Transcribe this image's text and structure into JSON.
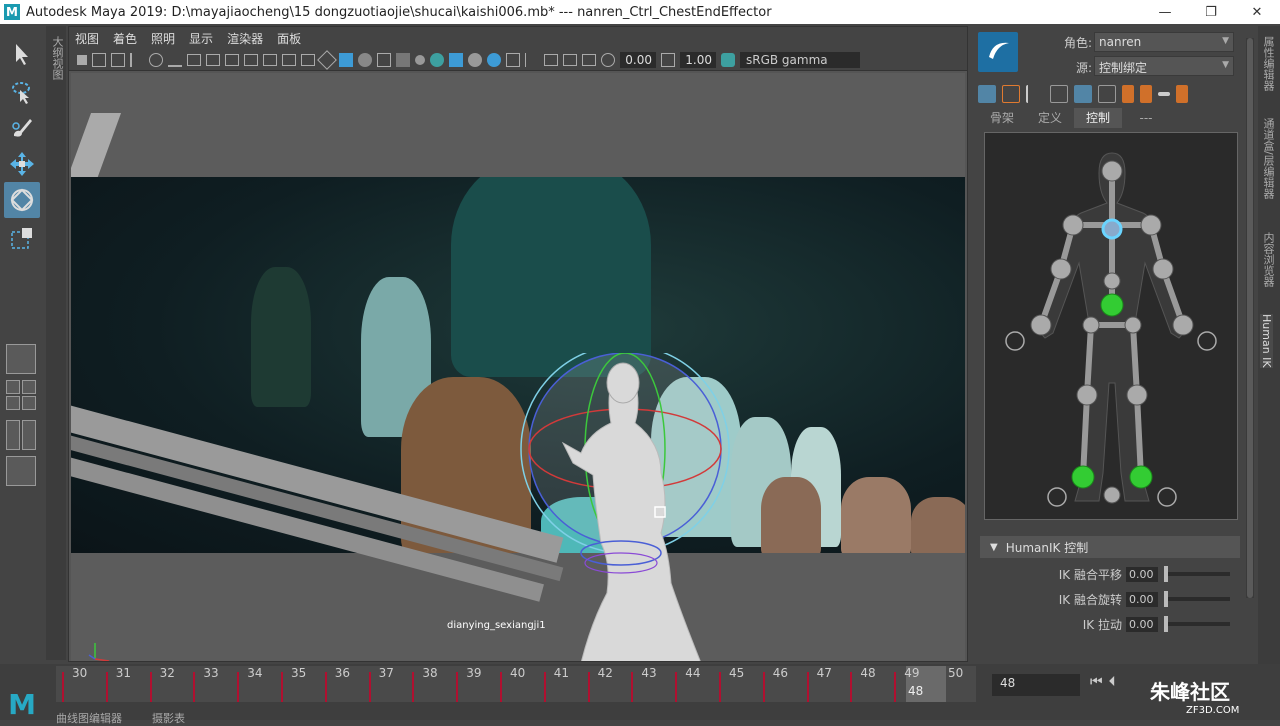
{
  "window": {
    "title": "Autodesk Maya 2019: D:\\mayajiaocheng\\15 dongzuotiaojie\\shucai\\kaishi006.mb*   ---   nanren_Ctrl_ChestEndEffector",
    "minimize": "—",
    "maximize": "❐",
    "close": "✕",
    "app_logo": "M"
  },
  "left_tab": "大纲视图",
  "viewport": {
    "menu": [
      "视图",
      "着色",
      "照明",
      "显示",
      "渲染器",
      "面板"
    ],
    "exposure": "0.00",
    "gamma": "1.00",
    "color_space": "sRGB gamma",
    "camera_label": "dianying_sexiangji1"
  },
  "right_panel": {
    "character_label": "角色:",
    "character_value": "nanren",
    "source_label": "源:",
    "source_value": "控制绑定",
    "tabs": [
      "骨架",
      "定义",
      "控制",
      "---"
    ],
    "active_tab": "控制",
    "section_title": "HumanIK 控制",
    "ik_rows": [
      {
        "label": "IK 融合平移",
        "value": "0.00"
      },
      {
        "label": "IK 融合旋转",
        "value": "0.00"
      },
      {
        "label": "IK 拉动",
        "value": "0.00"
      }
    ]
  },
  "right_tabs": [
    "属性编辑器",
    "通道盒/层编辑器",
    "内容浏览器",
    "Human IK"
  ],
  "timeline": {
    "ticks": [
      "30",
      "31",
      "32",
      "33",
      "34",
      "35",
      "36",
      "37",
      "38",
      "39",
      "40",
      "41",
      "42",
      "43",
      "44",
      "45",
      "46",
      "47",
      "48",
      "49",
      "50"
    ],
    "current_frame": "48",
    "current_frame_field": "48",
    "bottom_tabs": [
      "曲线图编辑器",
      "摄影表"
    ]
  },
  "watermark": {
    "text": "朱峰社区",
    "url": "ZF3D.COM"
  }
}
